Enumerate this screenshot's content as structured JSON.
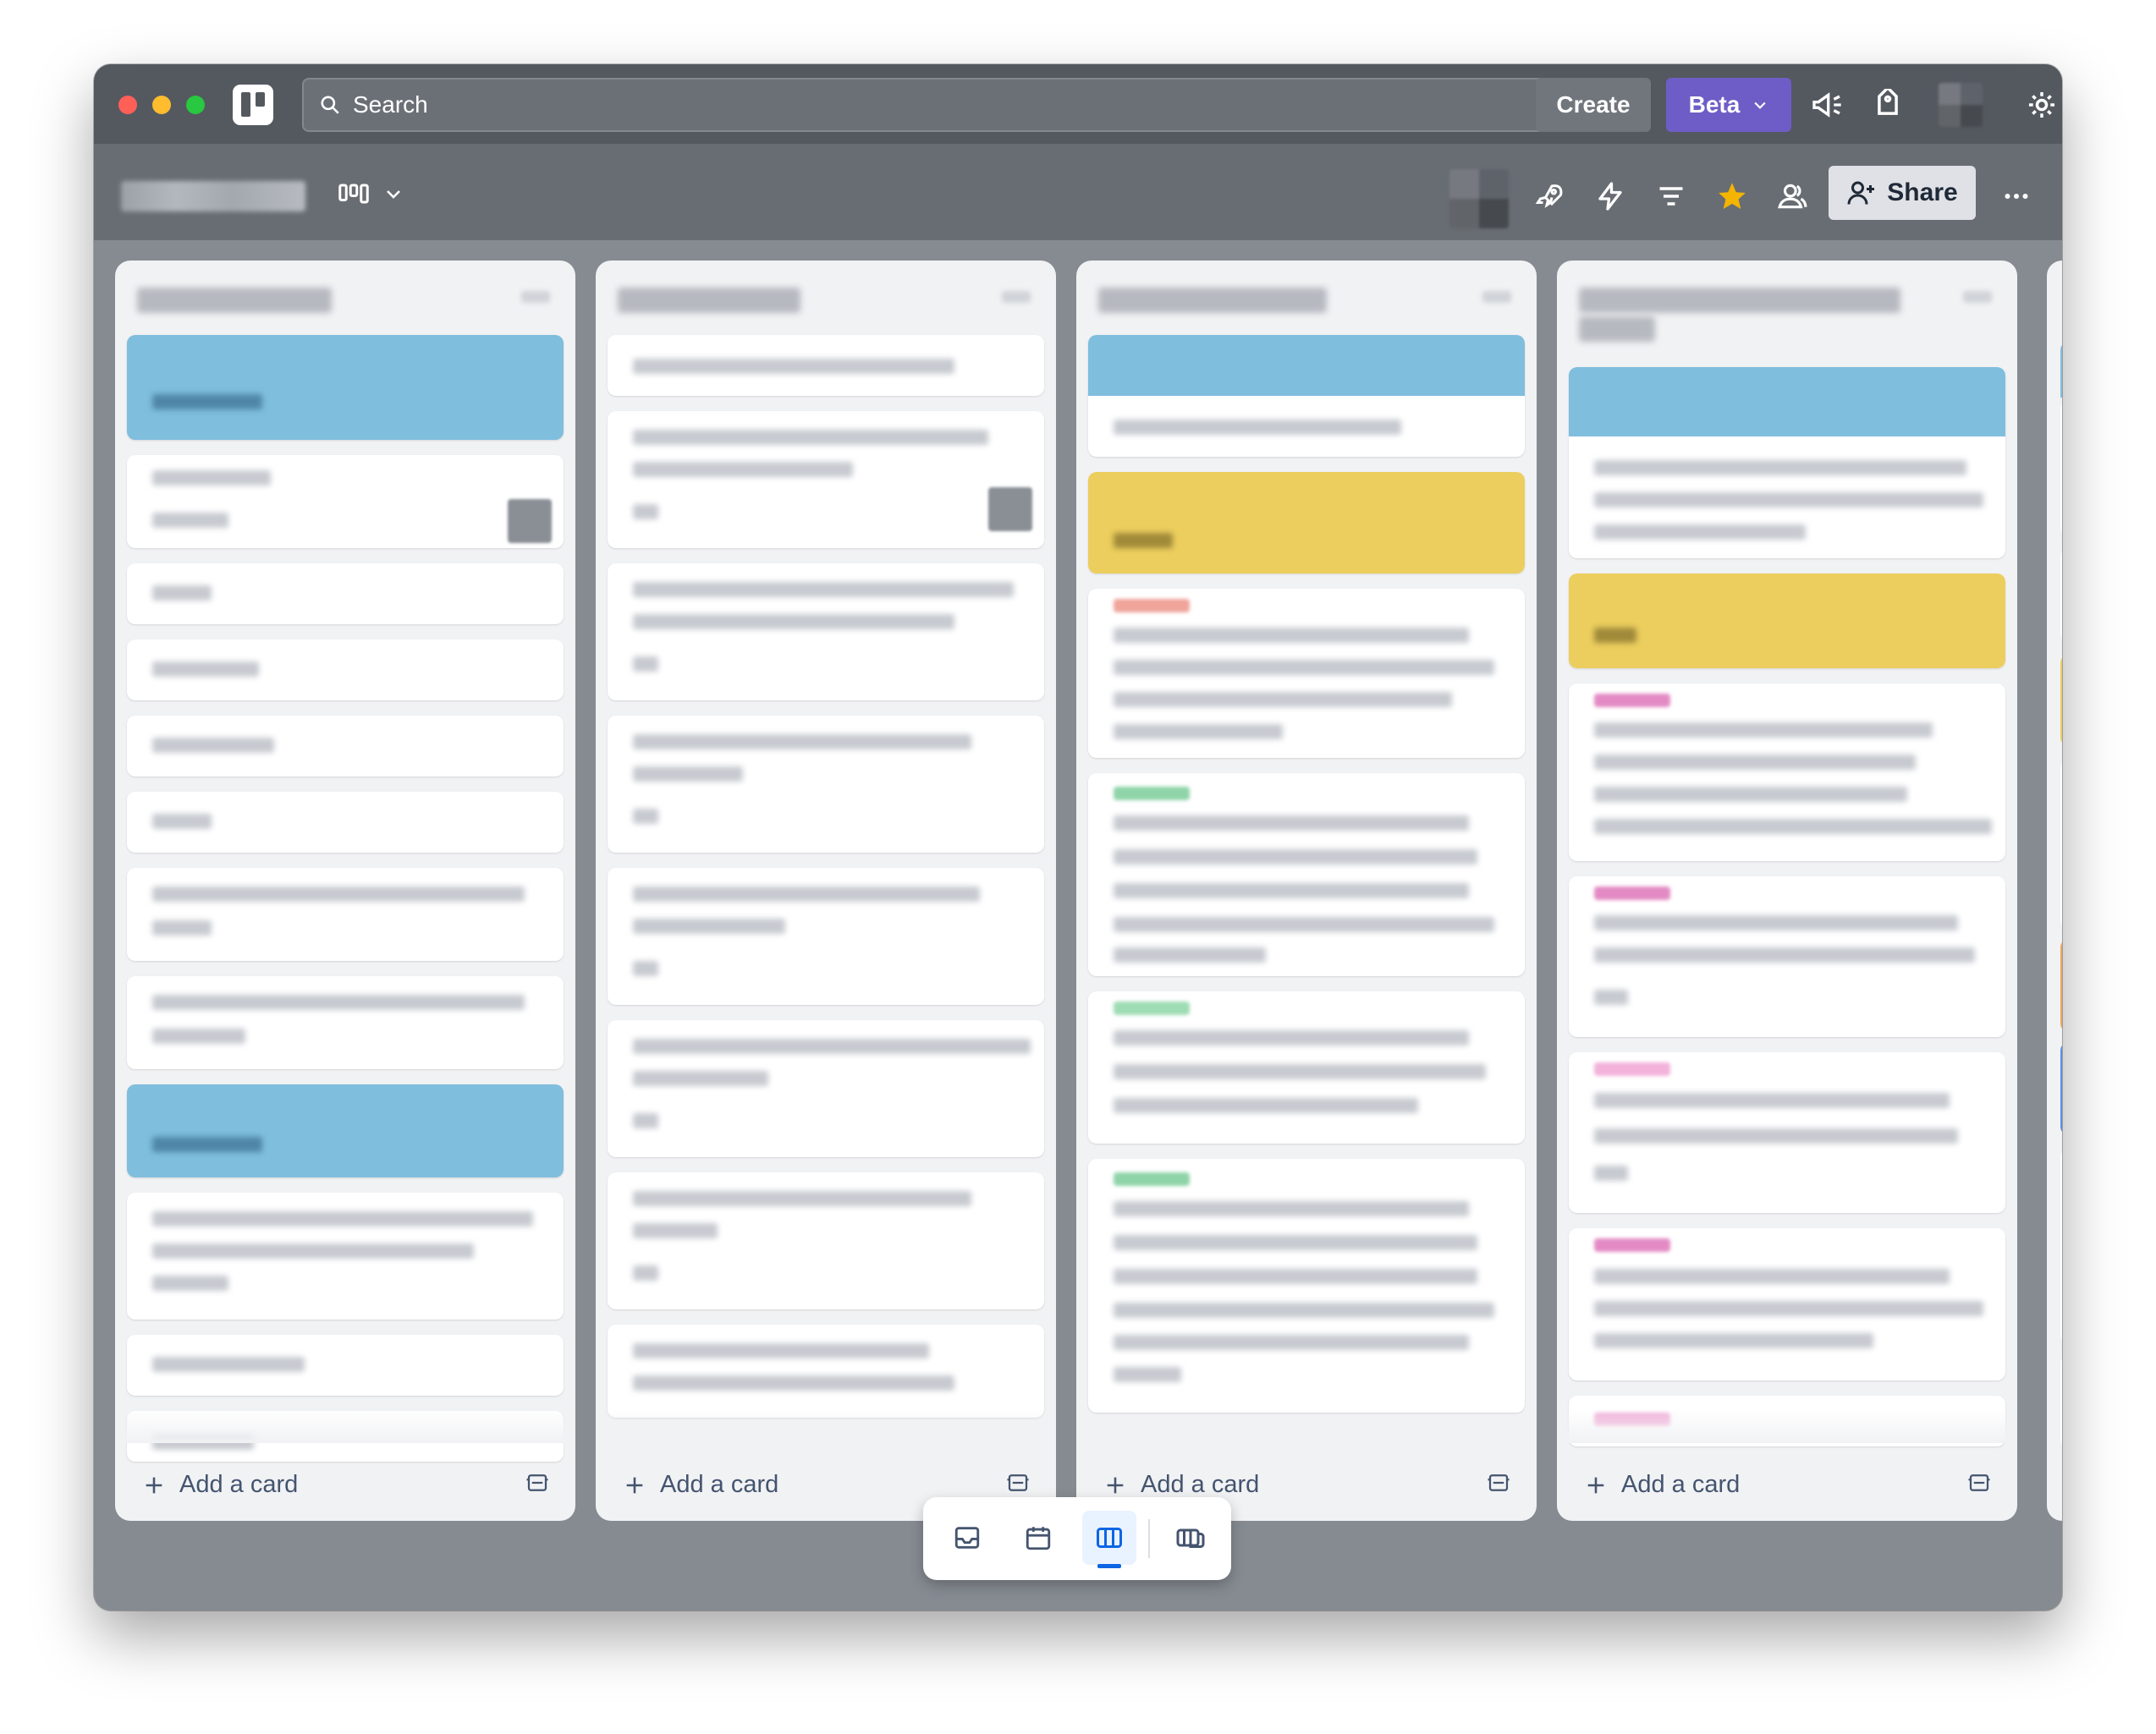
{
  "topbar": {
    "search_placeholder": "Search",
    "create_label": "Create",
    "beta_label": "Beta"
  },
  "boardbar": {
    "share_label": "Share"
  },
  "lists": [
    {
      "add_card_label": "Add a card"
    },
    {
      "add_card_label": "Add a card"
    },
    {
      "add_card_label": "Add a card"
    },
    {
      "add_card_label": "Add a card"
    }
  ],
  "colors": {
    "beta": "#6e5dc6",
    "star": "#f5b400",
    "active_view": "#0c66e4",
    "cover_blue": "#7fbedd",
    "cover_yellow": "#ecce5e"
  }
}
